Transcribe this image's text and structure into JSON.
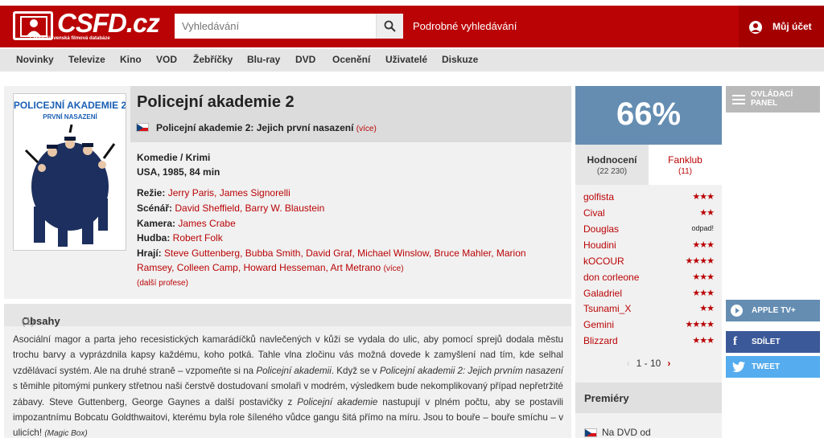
{
  "header": {
    "logo": "CSFD.cz",
    "logo_sub": "Česko-Slovenská filmová databáze",
    "search_placeholder": "Vyhledávání",
    "advanced_search": "Podrobné vyhledávání",
    "account": "Můj účet"
  },
  "nav": [
    "Novinky",
    "Televize",
    "Kino",
    "VOD",
    "Žebříčky",
    "Blu-ray",
    "DVD",
    "Ocenění",
    "Uživatelé",
    "Diskuze"
  ],
  "film": {
    "title": "Policejní akademie 2",
    "alt_title": "Policejní akademie 2: Jejich první nasazení",
    "more": "(více)",
    "genre": "Komedie / Krimi",
    "origin": "USA, 1985, 84 min",
    "credits": [
      {
        "label": "Režie:",
        "names": "Jerry Paris, James Signorelli"
      },
      {
        "label": "Scénář:",
        "names": "David Sheffield, Barry W. Blaustein"
      },
      {
        "label": "Kamera:",
        "names": "James Crabe"
      },
      {
        "label": "Hudba:",
        "names": "Robert Folk"
      },
      {
        "label": "Hrají:",
        "names": "Steve Guttenberg, Bubba Smith, David Graf, Michael Winslow, Bruce Mahler, Marion",
        "names2": "Ramsey, Colleen Camp, Howard Hesseman, Art Metrano",
        "more": "(více)"
      }
    ],
    "extra": "(další profese)",
    "poster_title_1": "POLICEJNÍ AKADEMIE 2",
    "poster_title_2": "PRVNÍ NASAZENÍ"
  },
  "plot": {
    "heading": "Obsahy",
    "count": "(1)",
    "p1": "Asociální magor a parta jeho recesistických kamarádíčků navlečených v kůži se vydala do ulic, aby pomocí sprejů dodala městu trochu barvy a vyprázdnila kapsy každému, koho potká. Tahle vlna zločinu vás možná dovede k zamyšlení nad tím, kde selhal vzdělávací systém. Ale na druhé straně – vzpomeňte si na ",
    "i1": "Policejní akademii",
    "p2": ". Když se v ",
    "i2": "Policejní akademii 2: Jejich prvním nasazení",
    "p3": " s těmihle pitomými punkery střetnou naši čerstvě dostudovaní smolaři v modrém, výsledkem bude nekomplikovaný případ nepřetržité zábavy. Steve Guttenberg, George Gaynes a další postavičky z ",
    "i3": "Policejní akademie",
    "p4": " nastupují v plném počtu, aby se postavili impozantnímu Bobcatu Goldthwaitovi, kterému byla role šíleného vůdce gangu šitá přímo na míru. Jsou to bouře – bouře smíchu – v ulicích!",
    "source": "(Magic Box)"
  },
  "rating": {
    "percent": "66%",
    "tab1": "Hodnocení",
    "tab1_count": "(22 230)",
    "tab2": "Fanklub",
    "tab2_count": "(11)",
    "raters": [
      {
        "name": "golfista",
        "stars": "★★★"
      },
      {
        "name": "Cival",
        "stars": "★★"
      },
      {
        "name": "Douglas",
        "text": "odpad!"
      },
      {
        "name": "Houdini",
        "stars": "★★★"
      },
      {
        "name": "kOCOUR",
        "stars": "★★★★"
      },
      {
        "name": "don corleone",
        "stars": "★★★"
      },
      {
        "name": "Galadriel",
        "stars": "★★★"
      },
      {
        "name": "Tsunami_X",
        "stars": "★★"
      },
      {
        "name": "Gemini",
        "stars": "★★★★"
      },
      {
        "name": "Blizzard",
        "stars": "★★★"
      }
    ],
    "pager": "1 - 10"
  },
  "premiery": {
    "heading": "Premiéry",
    "row": "Na DVD od"
  },
  "side": {
    "panel_1": "OVLÁDACÍ",
    "panel_2": "PANEL",
    "apple": "APPLE TV+",
    "share": "SDÍLET",
    "tweet": "TWEET"
  }
}
